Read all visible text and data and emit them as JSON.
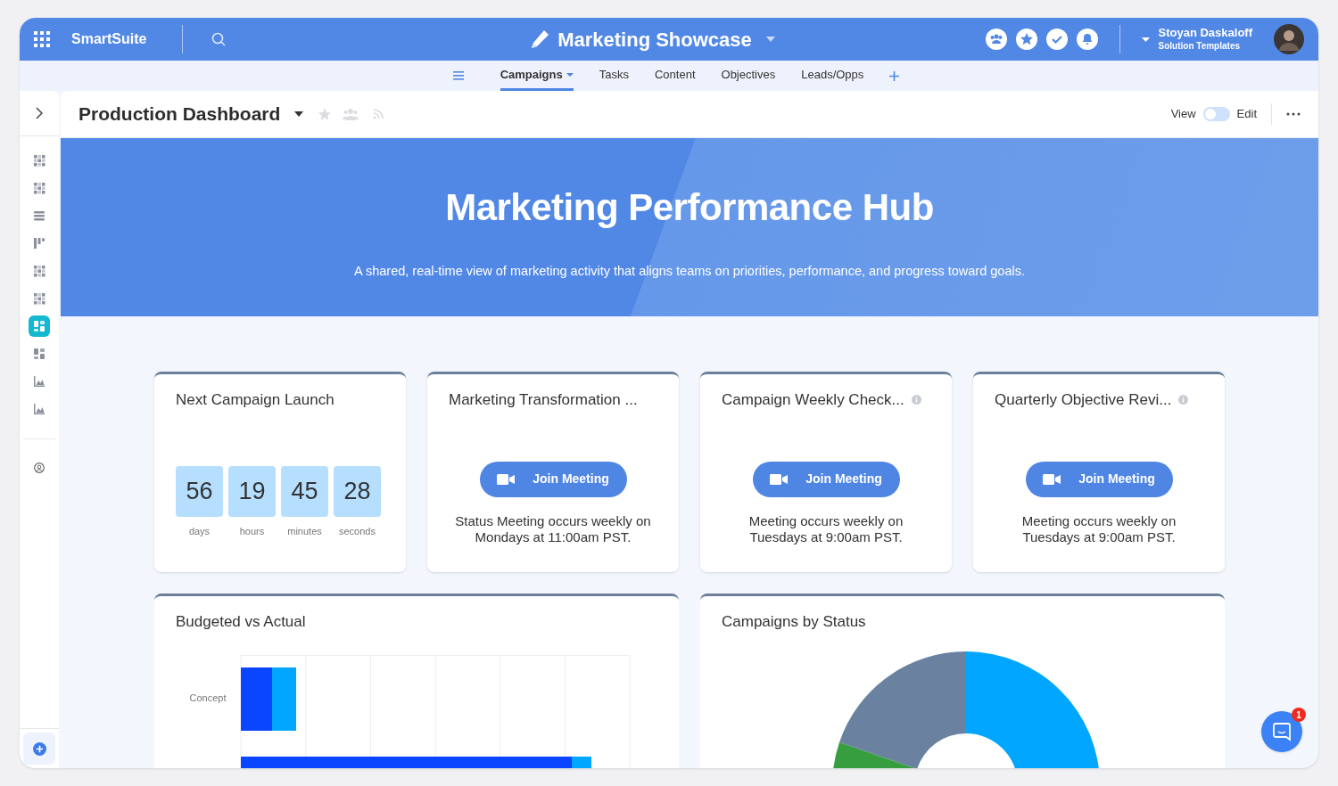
{
  "topbar": {
    "app_name": "SmartSuite",
    "workspace": "Marketing Showcase",
    "user": {
      "name": "Stoyan Daskaloff",
      "subtitle": "Solution Templates"
    }
  },
  "tabs": [
    {
      "label": "Campaigns",
      "selected": true,
      "dropdown": true
    },
    {
      "label": "Tasks",
      "selected": false,
      "dropdown": false
    },
    {
      "label": "Content",
      "selected": false,
      "dropdown": false
    },
    {
      "label": "Objectives",
      "selected": false,
      "dropdown": false
    },
    {
      "label": "Leads/Opps",
      "selected": false,
      "dropdown": false
    }
  ],
  "sidebar": {
    "items": [
      {
        "kind": "grid",
        "selected": false
      },
      {
        "kind": "grid",
        "selected": false
      },
      {
        "kind": "lines",
        "selected": false
      },
      {
        "kind": "kanban",
        "selected": false
      },
      {
        "kind": "grid",
        "selected": false
      },
      {
        "kind": "grid",
        "selected": false
      },
      {
        "kind": "dashboard",
        "selected": true
      },
      {
        "kind": "dashboard",
        "selected": false
      },
      {
        "kind": "chart",
        "selected": false
      },
      {
        "kind": "chart",
        "selected": false
      }
    ]
  },
  "header": {
    "title": "Production Dashboard",
    "view_label": "View",
    "edit_label": "Edit",
    "edit_mode": false
  },
  "banner": {
    "title": "Marketing Performance Hub",
    "subtitle": "A shared, real-time view of marketing activity that aligns teams on priorities, performance, and progress toward goals."
  },
  "cards": [
    {
      "kind": "countdown",
      "title": "Next Campaign Launch",
      "info": false,
      "units": [
        {
          "value": "56",
          "label": "days"
        },
        {
          "value": "19",
          "label": "hours"
        },
        {
          "value": "45",
          "label": "minutes"
        },
        {
          "value": "28",
          "label": "seconds"
        }
      ]
    },
    {
      "kind": "meeting",
      "title": "Marketing Transformation ...",
      "info": false,
      "button": "Join Meeting",
      "note": "Status Meeting occurs weekly on Mondays at 11:00am PST."
    },
    {
      "kind": "meeting",
      "title": "Campaign Weekly Check...",
      "info": true,
      "button": "Join Meeting",
      "note": "Meeting occurs weekly on Tuesdays at 9:00am PST."
    },
    {
      "kind": "meeting",
      "title": "Quarterly Objective Revi...",
      "info": true,
      "button": "Join Meeting",
      "note": "Meeting occurs weekly on Tuesdays at 9:00am PST."
    }
  ],
  "charts": [
    {
      "kind": "bars",
      "title": "Budgeted vs Actual",
      "row_labels": [
        "Concept"
      ]
    },
    {
      "kind": "donut",
      "title": "Campaigns by Status"
    }
  ],
  "chat": {
    "badge": "1"
  }
}
